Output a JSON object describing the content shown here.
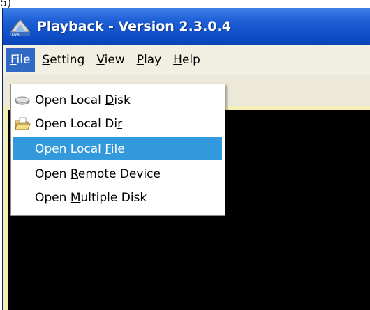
{
  "window": {
    "title": "Playback - Version 2.3.0.4"
  },
  "menubar": {
    "items": [
      {
        "label_pre": "",
        "label_key": "F",
        "label_post": "ile"
      },
      {
        "label_pre": "",
        "label_key": "S",
        "label_post": "etting"
      },
      {
        "label_pre": "",
        "label_key": "V",
        "label_post": "iew"
      },
      {
        "label_pre": "",
        "label_key": "P",
        "label_post": "lay"
      },
      {
        "label_pre": "",
        "label_key": "H",
        "label_post": "elp"
      }
    ]
  },
  "file_menu": {
    "items": [
      {
        "icon": "disk-drive-icon",
        "label_pre": "Open Local ",
        "label_key": "D",
        "label_post": "isk"
      },
      {
        "icon": "open-folder-icon",
        "label_pre": "Open Local Di",
        "label_key": "r",
        "label_post": ""
      },
      {
        "icon": "",
        "label_pre": "Open Local ",
        "label_key": "F",
        "label_post": "ile"
      },
      {
        "icon": "",
        "label_pre": "Open ",
        "label_key": "R",
        "label_post": "emote Device"
      },
      {
        "icon": "",
        "label_pre": "Open ",
        "label_key": "M",
        "label_post": "ultiple Disk"
      }
    ],
    "selected_index": 2
  },
  "colors": {
    "titlebar": "#0f4fc8",
    "menu_highlight": "#316ac5",
    "selected_item": "#3399dd",
    "video_area": "#000000"
  }
}
